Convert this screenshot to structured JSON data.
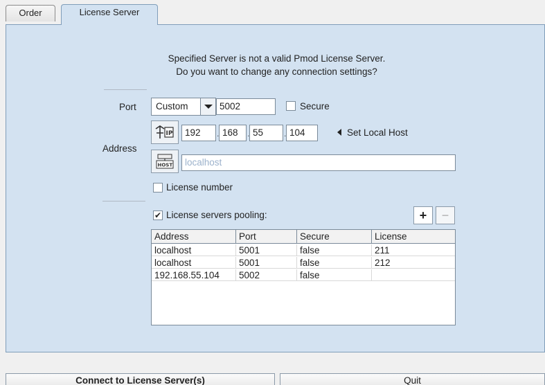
{
  "tabs": [
    {
      "label": "Order"
    },
    {
      "label": "License Server"
    }
  ],
  "message": {
    "line1": "Specified Server is not a valid Pmod License Server.",
    "line2": "Do you want to change any connection settings?"
  },
  "port": {
    "label": "Port",
    "mode": "Custom",
    "value": "5002",
    "secure_label": "Secure",
    "secure_checked": false
  },
  "address": {
    "label": "Address",
    "ip": [
      "192",
      "168",
      "55",
      "104"
    ],
    "set_local_host": "Set Local Host",
    "host_placeholder": "localhost",
    "ip_icon": "ip-network-icon",
    "host_icon": "host-computer-icon"
  },
  "license_number": {
    "label": "License number",
    "checked": false
  },
  "pooling": {
    "label": "License servers pooling:",
    "checked": true,
    "add_label": "+",
    "remove_label": "−"
  },
  "servers_table": {
    "columns": [
      "Address",
      "Port",
      "Secure",
      "License"
    ],
    "rows": [
      [
        "localhost",
        "5001",
        "false",
        "211"
      ],
      [
        "localhost",
        "5001",
        "false",
        "212"
      ],
      [
        "192.168.55.104",
        "5002",
        "false",
        ""
      ]
    ]
  },
  "buttons": {
    "connect": "Connect to License Server(s)",
    "quit": "Quit"
  },
  "colors": {
    "panel": "#d3e2f1",
    "border": "#7f9db9"
  }
}
